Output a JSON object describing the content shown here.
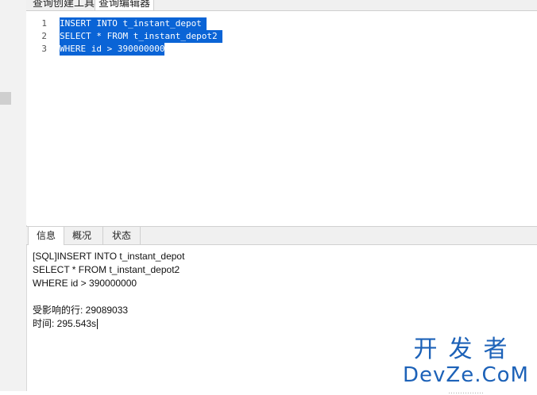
{
  "top_tabs": [
    {
      "label": "查询创建工具"
    },
    {
      "label": "查询编辑器"
    }
  ],
  "editor": {
    "line_numbers": [
      "1",
      "2",
      "3"
    ],
    "lines": [
      "INSERT INTO t_instant_depot ",
      "SELECT * FROM t_instant_depot2 ",
      "WHERE id > 390000000"
    ]
  },
  "bottom_tabs": [
    {
      "label": "信息"
    },
    {
      "label": "概况"
    },
    {
      "label": "状态"
    }
  ],
  "info": {
    "sql_line1": "[SQL]INSERT INTO t_instant_depot",
    "sql_line2": "SELECT * FROM t_instant_depot2",
    "sql_line3": "WHERE id > 390000000",
    "affected_rows": "受影响的行: 29089033",
    "time": "时间: 295.543s"
  },
  "watermark": {
    "cn": "开发者",
    "en": "DevZe.CoM",
    "sub": "……………"
  },
  "colors": {
    "selection": "#0a64d6",
    "watermark": "#1d62b8"
  }
}
